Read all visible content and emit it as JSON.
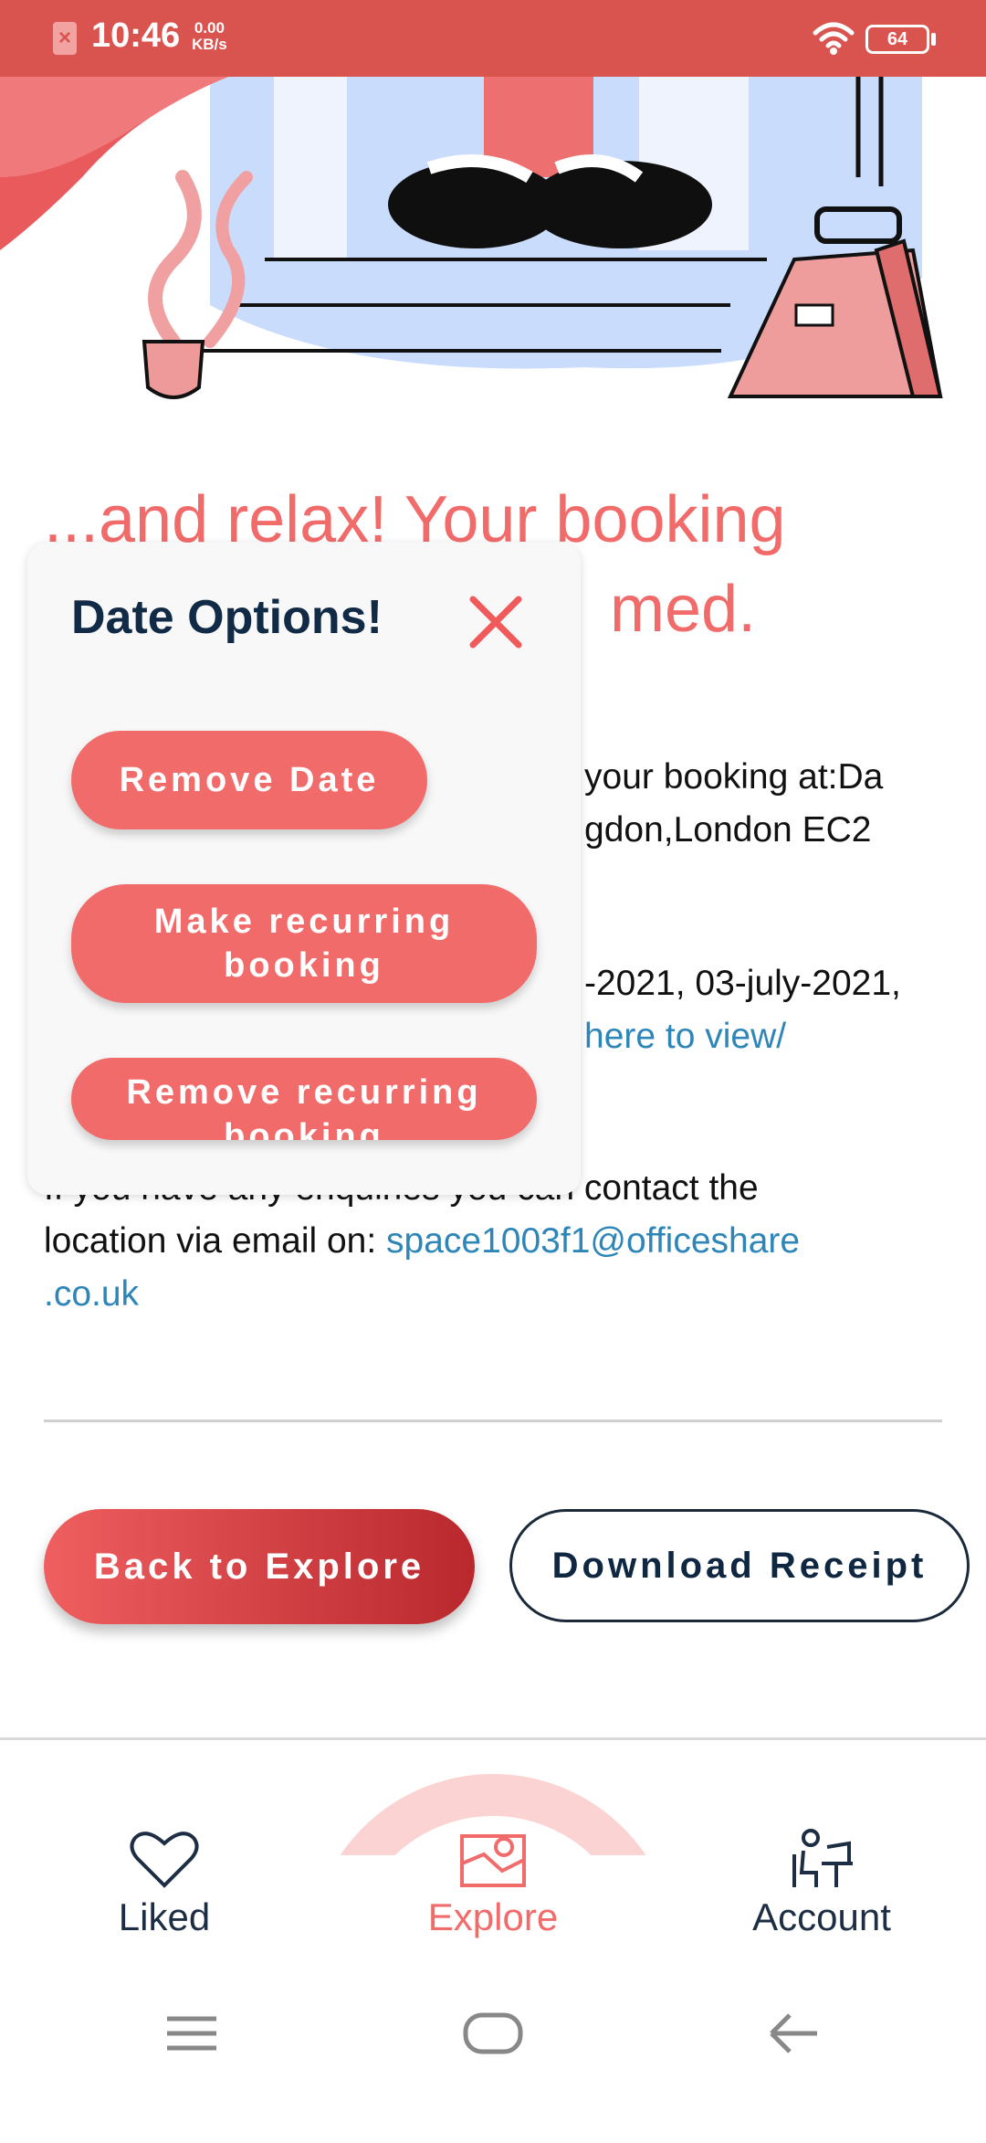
{
  "status_bar": {
    "time": "10:46",
    "speed_value": "0.00",
    "speed_unit": "KB/s",
    "battery": "64"
  },
  "confirmation": {
    "headline_line1": "...and relax! Your booking",
    "headline_line2": "med.",
    "line_booking_1": "your booking at:Da",
    "line_booking_2": "gdon,London EC2",
    "line_dates_1": "-2021, 03-july-2021,",
    "line_dates_2": "here to view/",
    "contact_line1": "If you have any enquiries you can contact the",
    "contact_line2_prefix": "location via email on: ",
    "contact_email_part1": "space1003f1@officeshare",
    "contact_email_part2": ".co.uk"
  },
  "actions": {
    "back_label": "Back to Explore",
    "receipt_label": "Download Receipt"
  },
  "date_options": {
    "title": "Date Options!",
    "remove_date": "Remove Date",
    "make_recurring": "Make recurring booking",
    "remove_recurring": "Remove recurring booking"
  },
  "bottom_nav": {
    "liked": "Liked",
    "explore": "Explore",
    "account": "Account"
  },
  "colors": {
    "accent": "#f26b6b",
    "status_bar": "#d9534f",
    "link": "#2e86b8",
    "navy": "#112a45"
  }
}
